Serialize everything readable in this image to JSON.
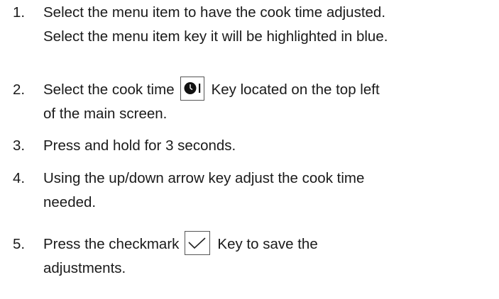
{
  "steps": [
    {
      "number": "1.",
      "lines": [
        "Select the menu item to have the cook time adjusted.",
        "Select the menu item key it will be highlighted in blue."
      ]
    },
    {
      "number": "2.",
      "before_icon": "Select the cook time",
      "icon": "cook-time-key-icon",
      "after_icon": "Key located on the top left",
      "line2": "of the main screen."
    },
    {
      "number": "3.",
      "lines": [
        "Press and hold for 3 seconds."
      ]
    },
    {
      "number": "4.",
      "lines": [
        "Using the up/down arrow key adjust the cook time",
        "needed."
      ]
    },
    {
      "number": "5.",
      "before_icon": "Press the checkmark",
      "icon": "checkmark-key-icon",
      "after_icon": "Key to save the",
      "line2": "adjustments."
    }
  ]
}
